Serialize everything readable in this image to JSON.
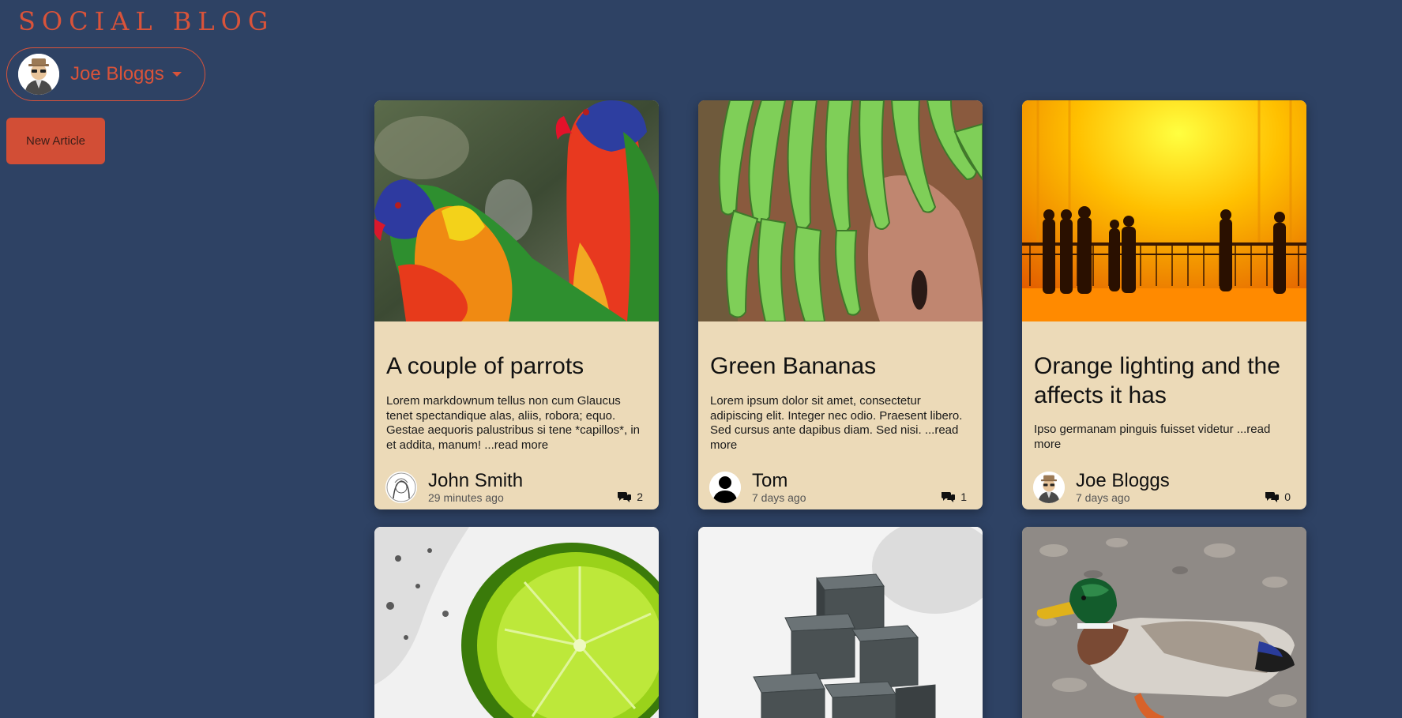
{
  "brand": "SOCIAL BLOG",
  "user_menu": {
    "name": "Joe Bloggs",
    "avatar_icon": "spy-avatar-icon"
  },
  "new_article_label": "New Article",
  "accent": "#d9533a",
  "background": "#2e4264",
  "cards": [
    {
      "title": "A couple of parrots",
      "excerpt": "Lorem markdownum tellus non cum Glaucus tenet spectandique alas, aliis, robora; equo. Gestae aequoris palustribus si tene *capillos*, in et addita, manum! ...read more",
      "author": "John Smith",
      "time": "29 minutes ago",
      "comments": "2",
      "image": "parrots"
    },
    {
      "title": "Green Bananas",
      "excerpt": "Lorem ipsum dolor sit amet, consectetur adipiscing elit. Integer nec odio. Praesent libero. Sed cursus ante dapibus diam. Sed nisi. ...read more",
      "author": "Tom",
      "time": "7 days ago",
      "comments": "1",
      "image": "bananas"
    },
    {
      "title": "Orange lighting and the affects it has",
      "excerpt": "Ipso germanam pinguis fuisset videtur ...read more",
      "author": "Joe Bloggs",
      "time": "7 days ago",
      "comments": "0",
      "image": "orange-hall"
    },
    {
      "image": "lime"
    },
    {
      "image": "cubes"
    },
    {
      "image": "duck"
    }
  ]
}
